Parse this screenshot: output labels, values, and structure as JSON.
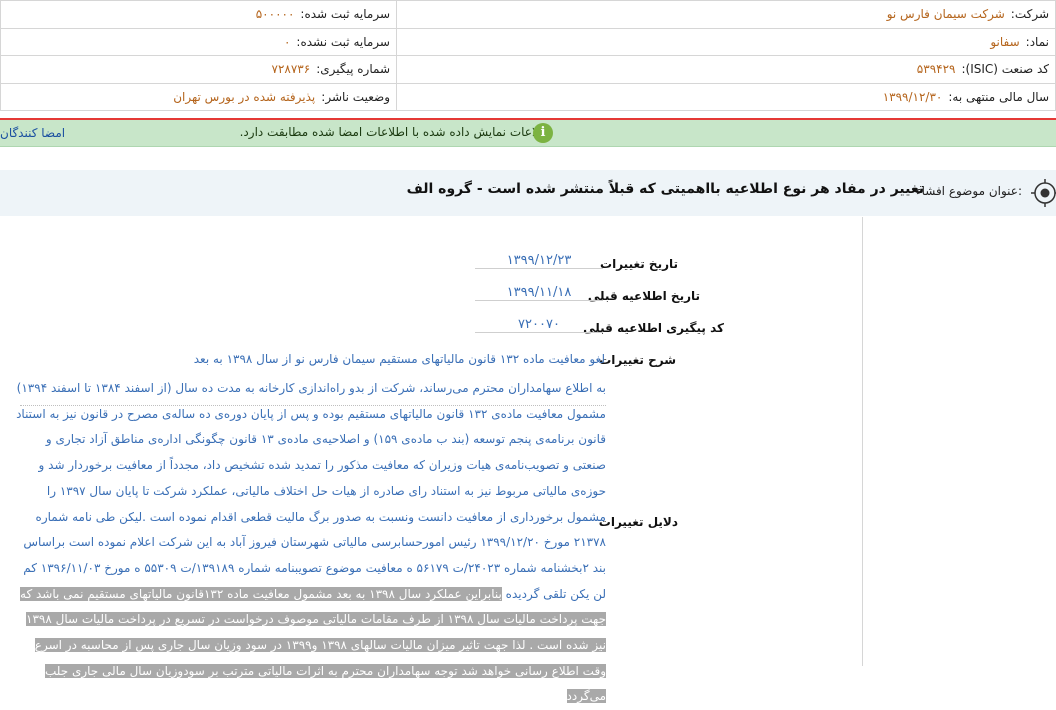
{
  "header": {
    "company_label": "شرکت:",
    "company_value": "شرکت سیمان فارس نو",
    "registered_capital_label": "سرمایه ثبت شده:",
    "registered_capital_value": "۵۰۰۰۰۰",
    "symbol_label": "نماد:",
    "symbol_value": "سفانو",
    "unregistered_capital_label": "سرمایه ثبت نشده:",
    "unregistered_capital_value": "۰",
    "isic_label": "کد صنعت (ISIC):",
    "isic_value": "۵۳۹۴۲۹",
    "tracking_label": "شماره پیگیری:",
    "tracking_value": "۷۲۸۷۳۶",
    "fiscal_year_label": "سال مالی منتهی به:",
    "fiscal_year_value": "۱۳۹۹/۱۲/۳۰",
    "publisher_status_label": "وضعیت ناشر:",
    "publisher_status_value": "پذیرفته شده در بورس تهران"
  },
  "notice": {
    "text": "اطلاعات نمایش داده شده با اطلاعات امضا شده مطابقت دارد.",
    "signers_link": "امضا کنندگان",
    "icon": "info-icon"
  },
  "subject": {
    "label": "عنوان موضوع افشاء:",
    "title": "تغییر در مفاد هر نوع اطلاعیه بااهمیتی که قبلاً منتشر شده است - گروه الف",
    "icon": "target-icon"
  },
  "fields": {
    "change_date_label": "تاریخ تغییرات",
    "change_date_value": "۱۳۹۹/۱۲/۲۳",
    "prev_notice_date_label": "تاریخ اطلاعیه قبلی",
    "prev_notice_date_value": "۱۳۹۹/۱۱/۱۸",
    "prev_tracking_label": "کد پیگیری اطلاعیه قبلی",
    "prev_tracking_value": "۷۲۰۰۷۰",
    "description_label": "شرح تغییرات",
    "description_value": "لغو معافیت ماده ۱۳۲ قانون مالیاتهای مستقیم سیمان فارس نو از سال ۱۳۹۸ به بعد",
    "reasons_label": "دلایل تغییرات",
    "reasons_intro": "به اطلاع سهامداران محترم می‌رساند، شرکت از بدو راه‌اندازی کارخانه به مدت ده سال (از اسفند ۱۳۸۴ تا اسفند ۱۳۹۴) مشمول",
    "reasons_plain": "معافیت ماده‌ی ۱۳۲ قانون مالیاتهای مستقیم بوده و پس از پایان دوره‌ی ده ساله‌ی مصرح در قانون نیز به استناد قانون برنامه‌ی پنجم توسعه (بند ب ماده‌ی ۱۵۹) و اصلاحیه‌ی ماده‌ی ۱۳ قانون چگونگی اداره‌ی مناطق آزاد تجاری و صنعتی و تصویب‌نامه‌ی هیات وزیران که معافیت مذکور را تمدید شده تشخیص داد، مجدداً از معافیت برخوردار شد و حوزه‌ی مالیاتی مربوط نیز به استناد رای صادره از هیات حل اختلاف مالیاتی، عملکرد شرکت تا پایان سال ۱۳۹۷ را مشمول برخورداری از معافیت دانست ونسبت به صدور برگ مالیت قطعی اقدام نموده است .لیکن طی نامه شماره ۲۱۳۷۸ مورخ ۱۳۹۹/۱۲/۲۰ رئیس امورحسابرسی مالیاتی شهرستان فیروز آباد به این شرکت اعلام نموده است براساس بند ۲بخشنامه شماره ۲۴۰۲۳/ت ۵۶۱۷۹ ه معافیت موضوع تصویبنامه شماره ۱۳۹۱۸۹/ت ۵۵۳۰۹ ه مورخ ۱۳۹۶/۱۱/۰۳ کم لن یکن تلقی گردیده",
    "reasons_highlighted": "بنابراین عملکرد سال ۱۳۹۸ به بعد مشمول معافیت ماده ۱۳۲قانون مالیاتهای مستقیم نمی باشد که جهت پرداخت مالیات سال ۱۳۹۸ از طرف مقامات مالیاتی موصوف درخواست در تسریع در پرداخت مالیات سال ۱۳۹۸ نیز شده است . لذا جهت تاثیر میزان مالیات سالهای ۱۳۹۸ و۱۳۹۹ در سود وزیان سال جاری پس از محاسبه در اسرع وقت اطلاع رسانی خواهد شد توجه سهامداران محترم به اثرات مالیاتی مترتب بر سودوزیان سال مالی جاری جلب می‌گردد"
  }
}
